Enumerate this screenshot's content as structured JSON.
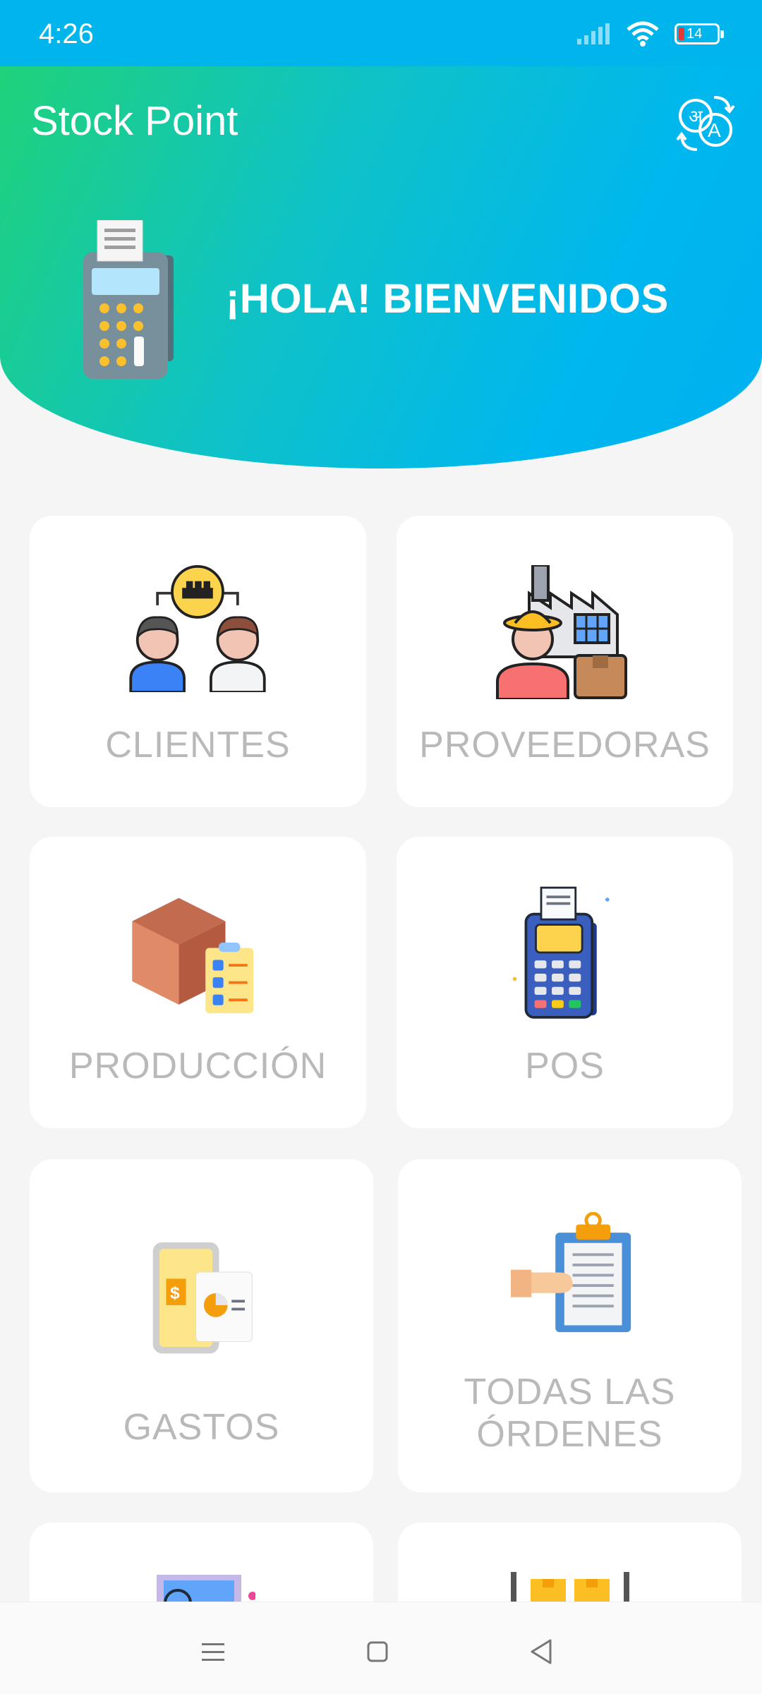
{
  "status_bar": {
    "time": "4:26",
    "battery": "14"
  },
  "header": {
    "app_title": "Stock Point",
    "welcome": "¡HOLA! BIENVENIDOS"
  },
  "cards": {
    "clientes": "CLIENTES",
    "proveedoras": "PROVEEDORAS",
    "produccion": "PRODUCCIÓN",
    "pos": "POS",
    "gastos": "GASTOS",
    "ordenes_line1": "TODAS LAS",
    "ordenes_line2": "ÓRDENES"
  },
  "icons": {
    "translate": "translate-icon",
    "clientes": "customers-icon",
    "proveedoras": "supplier-icon",
    "produccion": "production-box-icon",
    "pos": "pos-terminal-icon",
    "gastos": "expenses-icon",
    "ordenes": "orders-clipboard-icon"
  },
  "colors": {
    "status_bar": "#00b5ec",
    "gradient_start": "#1fd27a",
    "gradient_end": "#00b0ef",
    "card_label": "#b9b9b9"
  }
}
